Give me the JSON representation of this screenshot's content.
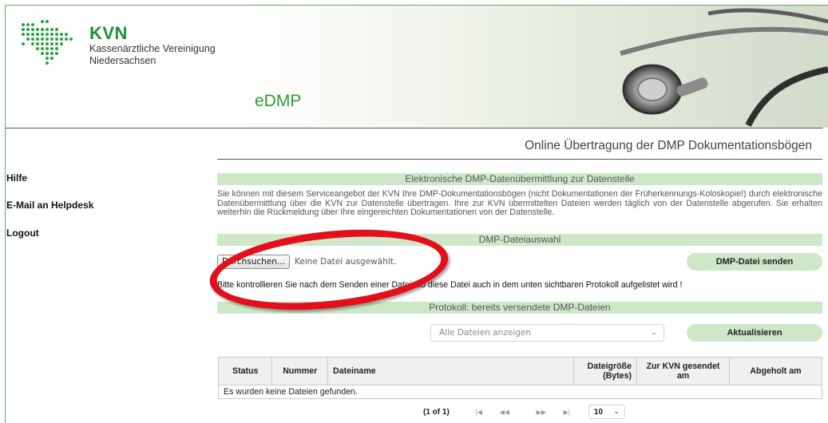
{
  "header": {
    "brand": "KVN",
    "brand_line1": "Kassenärztliche Vereinigung",
    "brand_line2": "Niedersachsen",
    "product": "eDMP",
    "subtitle": "Online Übertragung der DMP Dokumentationsbögen",
    "brand_color": "#1f8f3a"
  },
  "sidebar": {
    "items": [
      {
        "label": "Hilfe"
      },
      {
        "label": "E-Mail an Helpdesk"
      },
      {
        "label": "Logout"
      }
    ]
  },
  "main": {
    "section1_title": "Elektronische DMP-Datenübermittlung zur Datenstelle",
    "description": "Sie können mit diesem Serviceangebot der KVN Ihre DMP-Dokumentationsbögen (nicht Dokumentationen der Früherkennungs-Koloskopie!) durch elektronische Datenübermittlung über die KVN zur Datenstelle übertragen. Ihre zur KVN übermittelten Dateien werden täglich von der Datenstelle abgerufen. Sie erhalten weiterhin die Rückmeldung über Ihre eingereichten Dokumentationen von der Datenstelle.",
    "section2_title": "DMP-Dateiauswahl",
    "browse_label": "Durchsuchen...",
    "no_file_text": "Keine Datei ausgewählt.",
    "send_button": "DMP-Datei senden",
    "check_note": "Bitte kontrollieren Sie nach dem Senden einer Datei, ob diese Datei auch in dem unten sichtbaren Protokoll aufgelistet wird !",
    "section3_title": "Protokoll: bereits versendete DMP-Dateien",
    "filter_selected": "Alle Dateien anzeigen",
    "refresh_button": "Aktualisieren",
    "accent_color": "#cfe7c9"
  },
  "table": {
    "headers": [
      "Status",
      "Nummer",
      "Dateiname",
      "Dateigröße (Bytes)",
      "Zur KVN gesendet am",
      "Abgeholt am"
    ],
    "empty_message": "Es wurden keine Dateien gefunden."
  },
  "pager": {
    "info": "(1 of 1)",
    "first": "|◀",
    "prev": "◀◀",
    "next": "▶▶",
    "last": "▶|",
    "page_size": "10"
  },
  "annotation": {
    "color": "#e2101a"
  }
}
